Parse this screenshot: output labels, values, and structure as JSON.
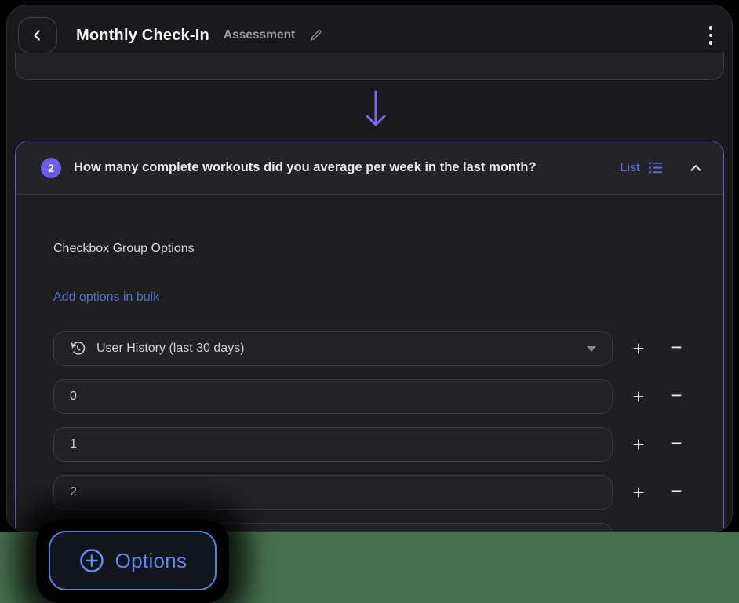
{
  "colors": {
    "accent_purple": "#6c5ce7",
    "card_border_purple": "#6a56d6",
    "arrow_purple": "#8066ee",
    "link_blue": "#4e72c8",
    "options_blue": "#6488e8",
    "backdrop_green": "#47704e"
  },
  "header": {
    "title": "Monthly Check-In",
    "subtitle": "Assessment"
  },
  "question_card": {
    "number": "2",
    "question": "How many complete workouts did you average per week in the last month?",
    "type_label": "List",
    "section_title": "Checkbox Group Options",
    "bulk_add_link": "Add options in bulk",
    "history_dropdown": {
      "value": "User History (last 30 days)"
    },
    "options": [
      "0",
      "1",
      "2"
    ],
    "row_controls": {
      "add": "+",
      "remove": "−"
    }
  },
  "options_button": {
    "label": "Options"
  }
}
